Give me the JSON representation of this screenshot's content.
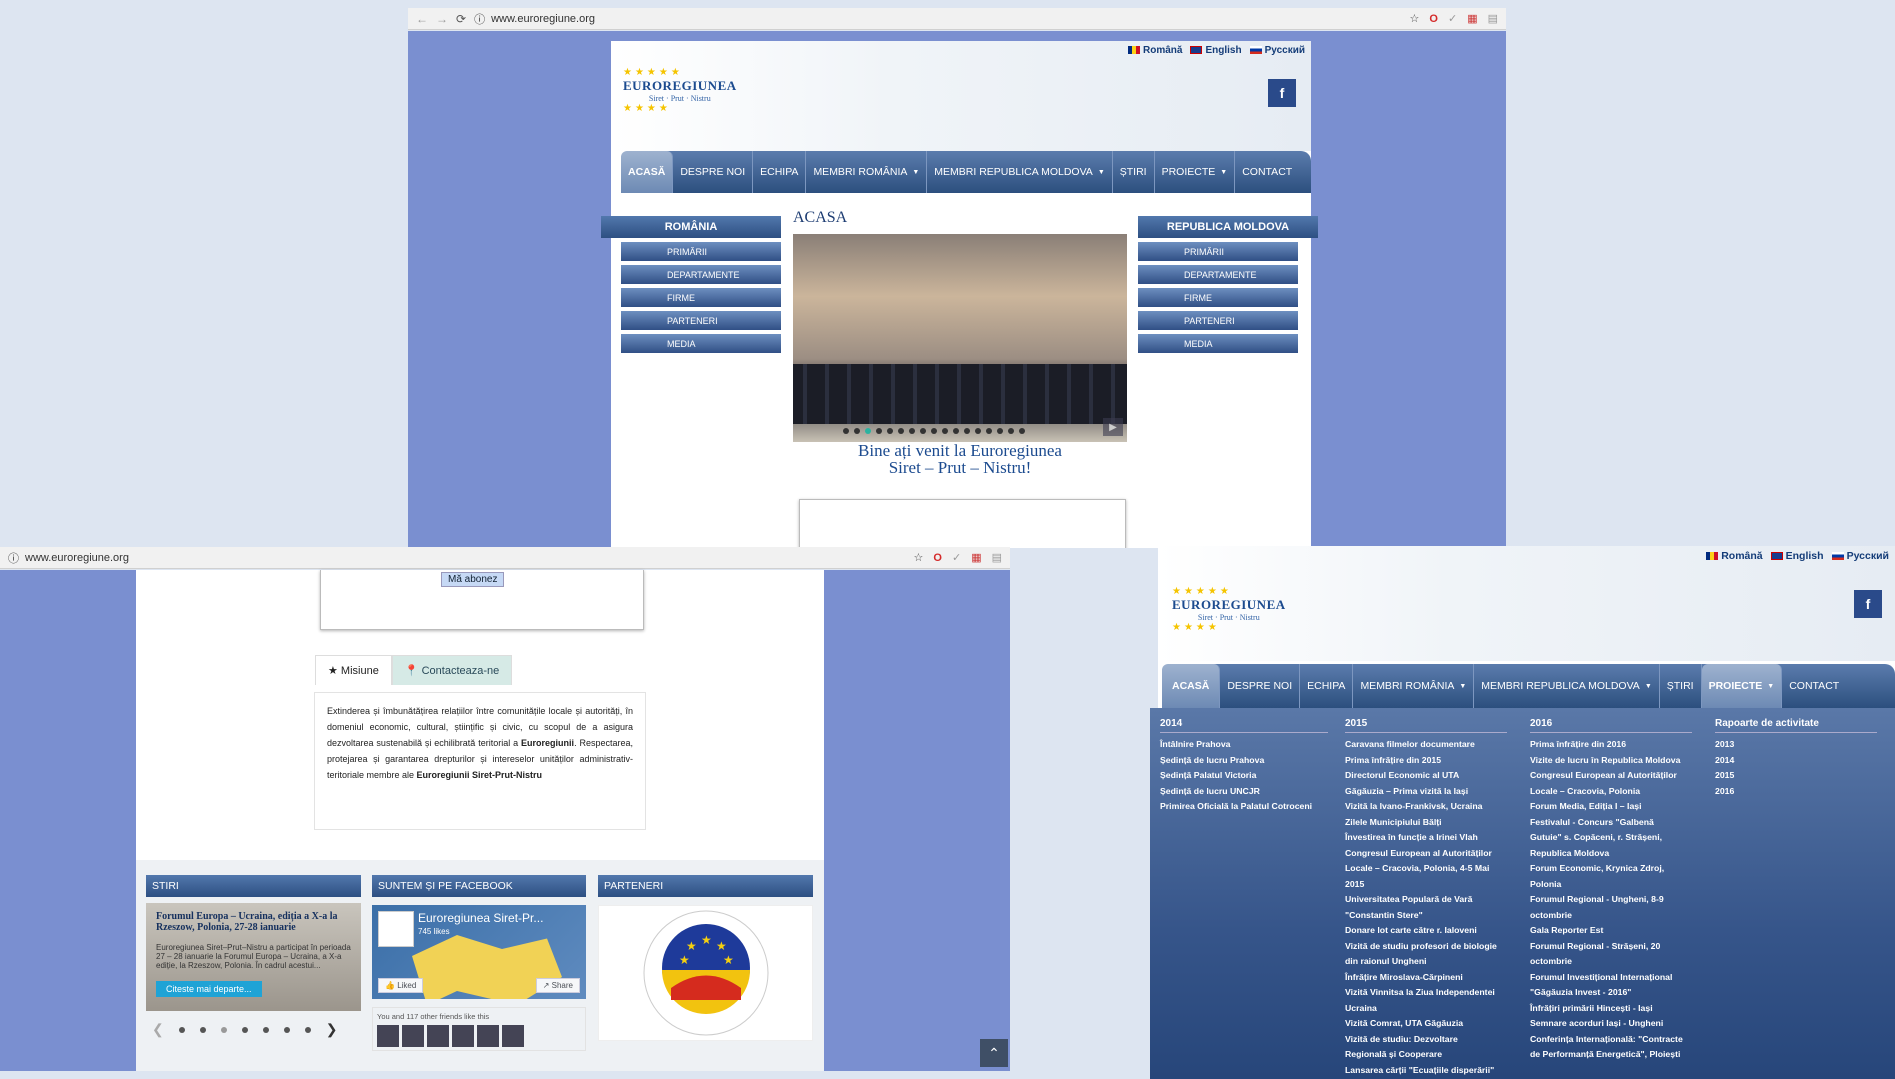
{
  "browser": {
    "url": "www.euroregiune.org"
  },
  "site": {
    "languages": [
      "Română",
      "English",
      "Русский"
    ],
    "logo": {
      "name": "EUROREGIUNEA",
      "sub": "Siret · Prut · Nistru"
    },
    "facebook_icon": "f",
    "menu": [
      "ACASĂ",
      "DESPRE NOI",
      "ECHIPA",
      "MEMBRI ROMÂNIA",
      "MEMBRI REPUBLICA MOLDOVA",
      "ȘTIRI",
      "PROIECTE",
      "CONTACT"
    ],
    "page_title": "ACASA",
    "romania": {
      "title": "ROMÂNIA",
      "items": [
        "PRIMĂRII",
        "DEPARTAMENTE",
        "FIRME",
        "PARTENERI",
        "MEDIA"
      ]
    },
    "moldova": {
      "title": "REPUBLICA MOLDOVA",
      "items": [
        "PRIMĂRII",
        "DEPARTAMENTE",
        "FIRME",
        "PARTENERI",
        "MEDIA"
      ]
    },
    "welcome_line1": "Bine ați venit la Euroregiunea",
    "welcome_line2": "Siret – Prut – Nistru!",
    "subscribe": "Mă abonez",
    "tabs": [
      "Misiune",
      "Contacteaza-ne"
    ],
    "mission": {
      "p1": "Extinderea și îmbunătățirea relațiilor între comunitățile locale și autorități, în domeniul economic, cultural, științific și civic, cu scopul de a asigura dezvoltarea sustenabilă și echilibrată teritorial a ",
      "b1": "Euroregiunii",
      "p2": ". Respectarea, protejarea și garantarea drepturilor și intereselor unităților administrativ-teritoriale membre ale ",
      "b2": "Euroregiunii Siret-Prut-Nistru"
    },
    "stiri": {
      "title": "STIRI",
      "card_title": "Forumul Europa – Ucraina, ediția a X-a la Rzeszow, Polonia, 27-28 ianuarie",
      "card_text": "Euroregiunea Siret–Prut–Nistru a participat în perioada 27 – 28 ianuarie la Forumul Europa – Ucraina, a X-a ediție, la Rzeszow, Polonia. În cadrul acestui...",
      "more": "Citeste mai departe..."
    },
    "facebook": {
      "title": "SUNTEM ȘI PE FACEBOOK",
      "page_name": "Euroregiunea Siret-Pr...",
      "likes": "745 likes",
      "liked": "Liked",
      "share": "Share",
      "friends": "You and 117 other friends like this"
    },
    "parteneri": {
      "title": "PARTENERI"
    },
    "proiecte_menu": {
      "columns": [
        {
          "title": "2014",
          "items": [
            "Întâlnire Prahova",
            "Ședință de lucru Prahova",
            "Ședință Palatul Victoria",
            "Ședință de lucru UNCJR",
            "Primirea Oficială la Palatul Cotroceni"
          ]
        },
        {
          "title": "2015",
          "items": [
            "Caravana filmelor documentare",
            "Prima înfrățire din 2015",
            "Directorul Economic al UTA",
            "Găgăuzia – Prima vizită la Iași",
            "Vizită la Ivano-Frankivsk, Ucraina",
            "Zilele Municipiului Bălți",
            "Învestirea în funcție a Irinei Vlah",
            "Congresul European al Autorităților",
            "Locale – Cracovia, Polonia, 4-5 Mai",
            "2015",
            "Universitatea Populară de Vară",
            "\"Constantin Stere\"",
            "Donare lot carte către r. Ialoveni",
            "Vizită de studiu profesori de biologie",
            "din raionul Ungheni",
            "Înfrățire Miroslava-Cărpineni",
            "Vizită Vinnitsa la Ziua Independentei",
            "Ucraina",
            "Vizită Comrat, UTA Găgăuzia",
            "Vizită de studiu: Dezvoltare",
            "Regională și Cooperare",
            "Lansarea cărții \"Ecuațiile disperării\""
          ]
        },
        {
          "title": "2016",
          "items": [
            "Prima înfrățire din 2016",
            "Vizite de lucru în Republica Moldova",
            "Congresul European al Autorităților",
            "Locale – Cracovia, Polonia",
            "Forum Media, Ediția I – Iași",
            "Festivalul - Concurs \"Galbenă",
            "Gutuie\" s. Copăceni, r. Strășeni,",
            "Republica Moldova",
            "Forum Economic, Krynica Zdroj,",
            "Polonia",
            "Forumul Regional - Ungheni, 8-9",
            "octombrie",
            "Gala Reporter Est",
            "Forumul Regional - Strășeni, 20",
            "octombrie",
            "Forumul Investițional Internațional",
            "\"Găgăuzia Invest - 2016\"",
            "Înfrățiri primării Hincești - Iași",
            "Semnare acorduri Iași - Ungheni",
            "Conferința Internațională: \"Contracte",
            "de Performanță Energetică\", Ploiești"
          ]
        },
        {
          "title": "Rapoarte de activitate",
          "items": [
            "2013",
            "2014",
            "2015",
            "2016"
          ]
        }
      ]
    }
  }
}
